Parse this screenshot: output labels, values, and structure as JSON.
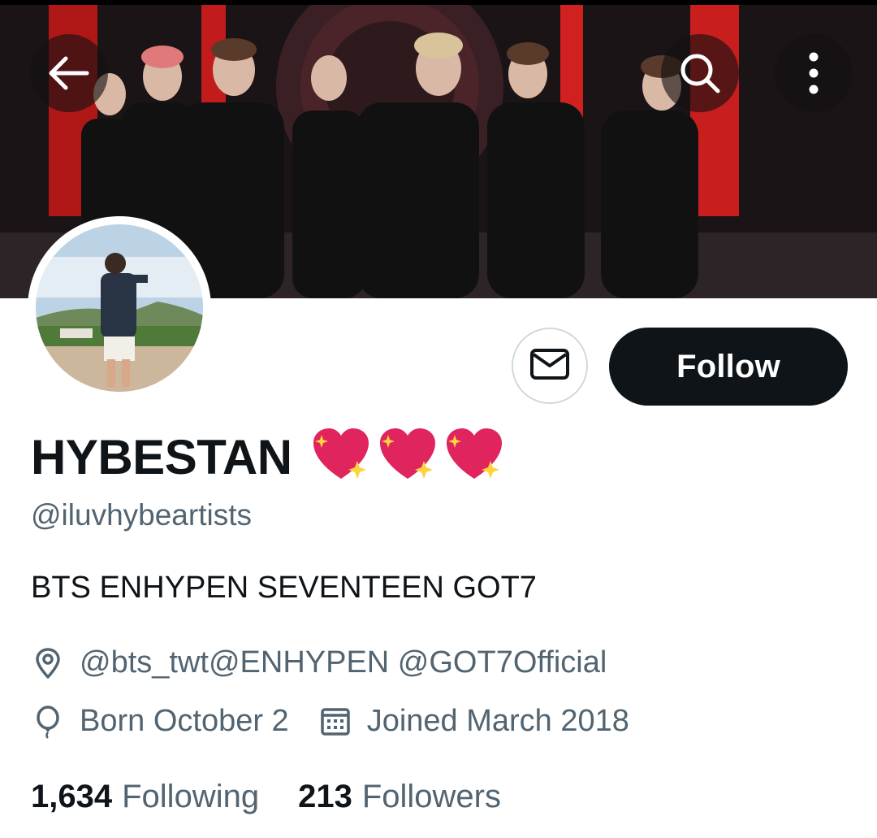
{
  "header": {
    "back_icon": "arrow-left-icon",
    "search_icon": "search-icon",
    "more_icon": "more-vertical-icon"
  },
  "profile": {
    "display_name": "HYBESTAN",
    "name_emoji": "sparkling-heart x3",
    "handle": "@iluvhybeartists",
    "bio": "BTS ENHYPEN SEVENTEEN GOT7",
    "location": "@bts_twt@ENHYPEN @GOT7Official",
    "birthday": "Born October 2",
    "joined": "Joined March 2018"
  },
  "actions": {
    "message_icon": "envelope-icon",
    "follow_label": "Follow"
  },
  "stats": {
    "following_count": "1,634",
    "following_label": "Following",
    "followers_count": "213",
    "followers_label": "Followers"
  },
  "colors": {
    "primary_text": "#0f1419",
    "secondary_text": "#536471",
    "heart": "#e0245e",
    "follow_bg": "#0f1419"
  }
}
